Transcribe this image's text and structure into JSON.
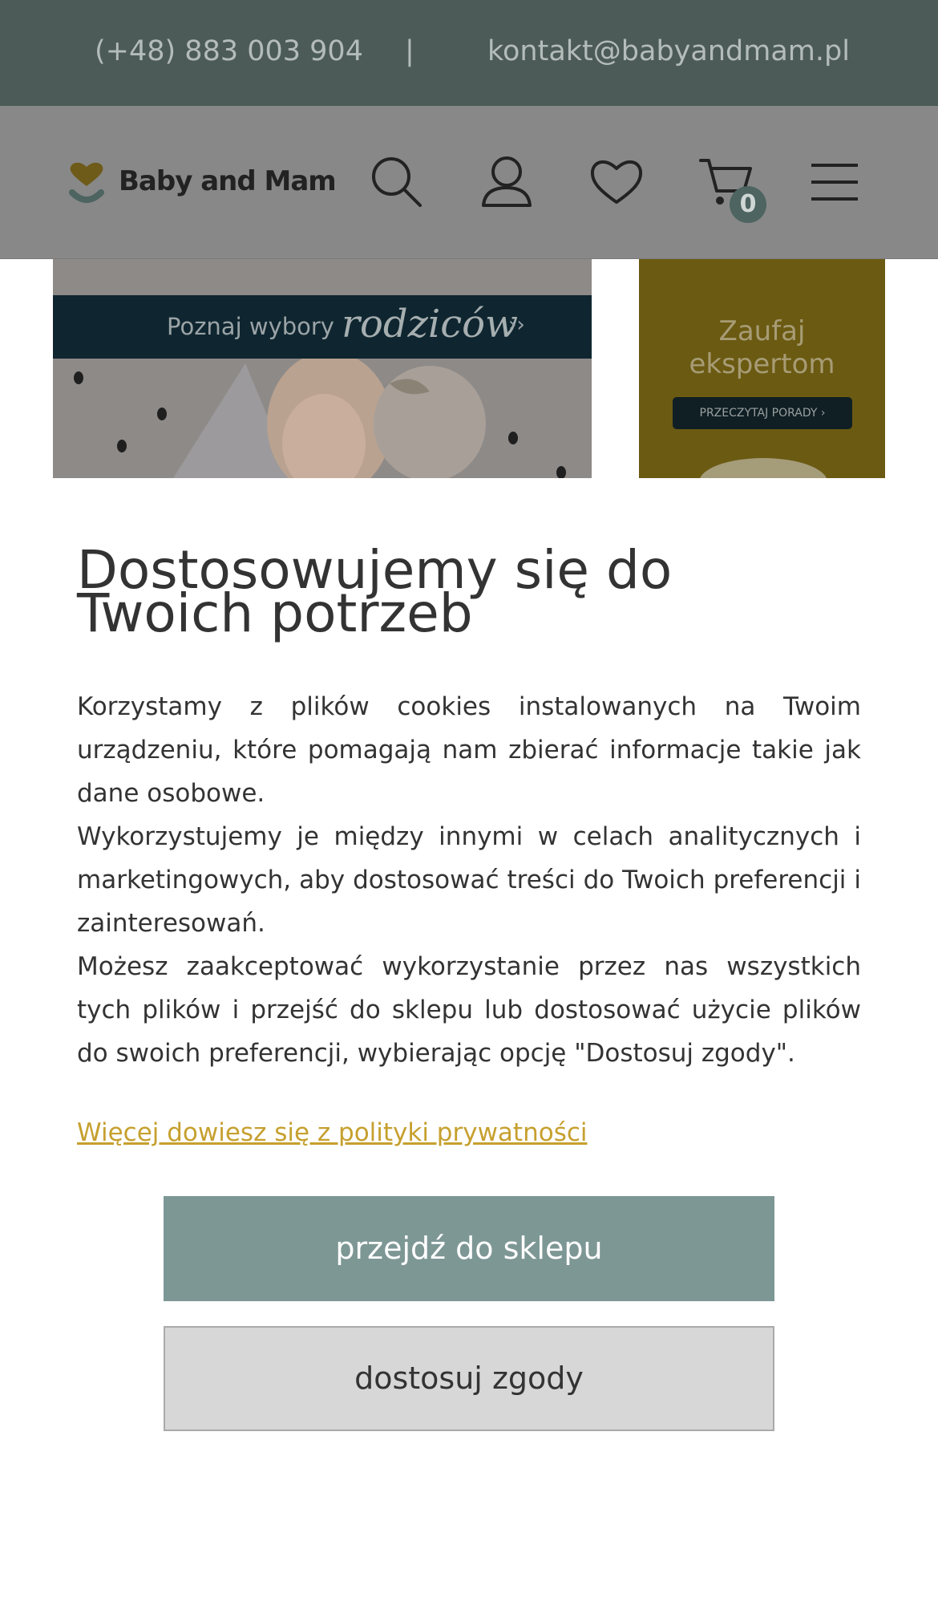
{
  "topbar": {
    "phone": "(+48) 883 003 904",
    "separator": "|",
    "email": "kontakt@babyandmam.pl"
  },
  "header": {
    "brand": "Baby and Mam",
    "icons": [
      "search-icon",
      "user-icon",
      "heart-icon",
      "cart-icon",
      "menu-icon"
    ],
    "cart_count": "0"
  },
  "hero": {
    "strip_text": "Poznaj wybory",
    "strip_script": "rodziców",
    "strip_arrow": "››"
  },
  "promo": {
    "title_line1": "Zaufaj",
    "title_line2": "ekspertom",
    "cta": "PRZECZYTAJ PORADY ›"
  },
  "cookie_modal": {
    "title": "Dostosowujemy się do Twoich potrzeb",
    "paragraphs": [
      "Korzystamy z plików cookies instalowanych na Twoim urządzeniu, które pomagają nam zbierać informacje takie jak dane osobowe.",
      "Wykorzystujemy je między innymi w celach analitycznych i marketingowych, aby dostosować treści do Twoich preferencji i zainteresowań.",
      "Możesz zaakceptować wykorzystanie przez nas wszystkich tych plików i przejść do sklepu lub dostosować użycie plików do swoich preferencji, wybierając opcję \"Dostosuj zgody\"."
    ],
    "privacy_link": "Więcej dowiesz się z polityki prywatności",
    "accept_button": "przejdź do sklepu",
    "customize_button": "dostosuj zgody"
  },
  "colors": {
    "topbar_bg": "#4c5b58",
    "accent_gold": "#c6a02f",
    "primary_button": "#7d9795"
  }
}
